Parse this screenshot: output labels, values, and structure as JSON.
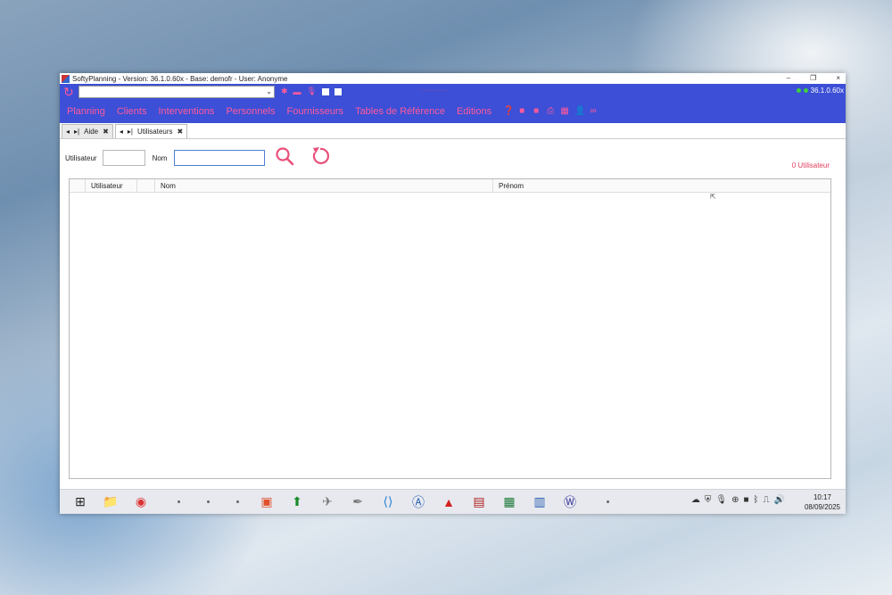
{
  "window": {
    "title": "SoftyPlanning - Version: 36.1.0.60x - Base: demofr - User: Anonyme",
    "controls": [
      "–",
      "❐",
      "×"
    ]
  },
  "toolbar": {
    "combo_value": "",
    "center_label": "···········",
    "version": "36.1.0.60x"
  },
  "menu": {
    "items": [
      "Planning",
      "Clients",
      "Interventions",
      "Personnels",
      "Fournisseurs",
      "Tables de Référence",
      "Editions"
    ]
  },
  "tabs": [
    {
      "label": "Aide"
    },
    {
      "label": "Utilisateurs"
    }
  ],
  "filter": {
    "utilisateur_label": "Utilisateur",
    "utilisateur_value": "",
    "nom_label": "Nom",
    "nom_value": ""
  },
  "count": "0 Utilisateur",
  "grid": {
    "columns": [
      "Utilisateur",
      "Nom",
      "Prénom"
    ]
  },
  "taskbar": {
    "time": "10:17",
    "date": "08/09/2025"
  },
  "colors": {
    "accent": "#3c4fd6",
    "pink": "#ff5a9c"
  }
}
